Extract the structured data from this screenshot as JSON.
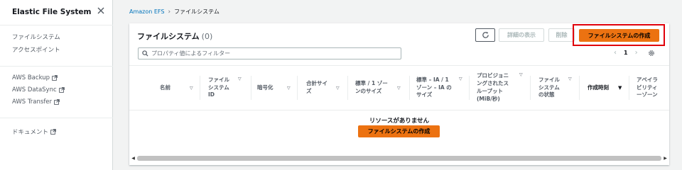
{
  "sidebar": {
    "title": "Elastic File System",
    "group1": [
      "ファイルシステム",
      "アクセスポイント"
    ],
    "group2": [
      "AWS Backup",
      "AWS DataSync",
      "AWS Transfer"
    ],
    "group3": [
      "ドキュメント"
    ]
  },
  "breadcrumb": {
    "root": "Amazon EFS",
    "current": "ファイルシステム"
  },
  "panel": {
    "title": "ファイルシステム",
    "count": "(0)",
    "details_label": "詳細の表示",
    "delete_label": "削除",
    "create_label": "ファイルシステムの作成",
    "search_placeholder": "プロパティ値によるフィルター",
    "page_number": "1"
  },
  "table": {
    "columns": [
      [
        "名前"
      ],
      [
        "ファイル",
        "システム",
        "ID"
      ],
      [
        "暗号化"
      ],
      [
        "合計サイ",
        "ズ"
      ],
      [
        "標準 / 1 ゾー",
        "ンのサイズ"
      ],
      [
        "標準 – IA / 1",
        "ゾーン – IA の",
        "サイズ"
      ],
      [
        "プロビジョニ",
        "ングされたス",
        "ループット",
        "(MiB/秒)"
      ],
      [
        "ファイル",
        "システム",
        "の状態"
      ],
      [
        "作成時刻"
      ],
      [
        "アベイラ",
        "ビリティ",
        "ーゾーン"
      ]
    ]
  },
  "empty": {
    "title": "リソースがありません",
    "create_label": "ファイルシステムの作成"
  },
  "colors": {
    "accent": "#ec7211",
    "highlight": "#e0000a",
    "link": "#0073bb"
  }
}
